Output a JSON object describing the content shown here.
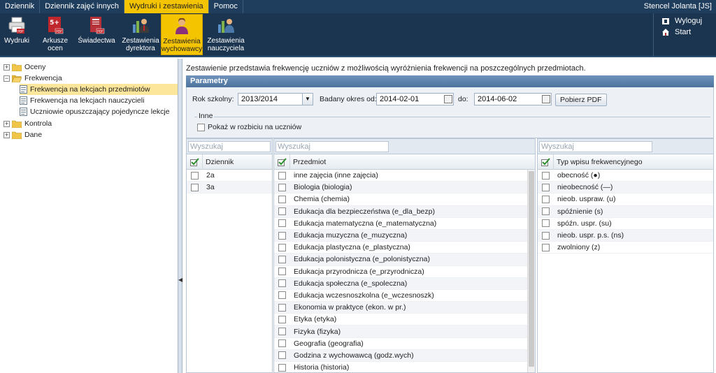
{
  "menubar": {
    "tabs": [
      "Dziennik",
      "Dziennik zajęć innych",
      "Wydruki i zestawienia",
      "Pomoc"
    ],
    "active_tab": "Wydruki i zestawienia",
    "user": "Stencel Jolanta [JS]"
  },
  "ribbon": {
    "buttons": [
      {
        "line1": "Wydruki",
        "line2": ""
      },
      {
        "line1": "Arkusze",
        "line2": "ocen"
      },
      {
        "line1": "Świadectwa",
        "line2": ""
      },
      {
        "line1": "Zestawienia",
        "line2": "dyrektora"
      },
      {
        "line1": "Zestawienia",
        "line2": "wychowawcy"
      },
      {
        "line1": "Zestawienia",
        "line2": "nauczyciela"
      }
    ],
    "badge_ocen": "5+",
    "pdf_badge": "PDF",
    "logout": "Wyloguj",
    "start": "Start"
  },
  "tree": {
    "oceny": "Oceny",
    "frekwencja": "Frekwencja",
    "freq_children": [
      "Frekwencja na lekcjach przedmiotów",
      "Frekwencja na lekcjach nauczycieli",
      "Uczniowie opuszczający pojedyncze lekcje"
    ],
    "kontrola": "Kontrola",
    "dane": "Dane",
    "expander_plus": "+",
    "expander_minus": "−"
  },
  "main": {
    "description": "Zestawienie przedstawia frekwencję uczniów z możliwością wyróżnienia frekwencji na poszczególnych przedmiotach.",
    "panel_title": "Parametry",
    "rok_label": "Rok szkolny:",
    "rok_value": "2013/2014",
    "okres_label": "Badany okres od:",
    "date_from": "2014-02-01",
    "do_label": "do:",
    "date_to": "2014-06-02",
    "pdf_button": "Pobierz PDF",
    "inne_legend": "Inne",
    "pokaz_label": "Pokaż w rozbiciu na uczniów",
    "dropdown_glyph": "▼"
  },
  "grids": {
    "search_placeholder": "Wyszukaj",
    "dziennik": {
      "header": "Dziennik",
      "rows": [
        "2a",
        "3a"
      ]
    },
    "przedmiot": {
      "header": "Przedmiot",
      "rows": [
        "inne zajęcia (inne zajęcia)",
        "Biologia (biologia)",
        "Chemia (chemia)",
        "Edukacja dla bezpieczeństwa (e_dla_bezp)",
        "Edukacja matematyczna (e_matematyczna)",
        "Edukacja muzyczna (e_muzyczna)",
        "Edukacja plastyczna (e_plastyczna)",
        "Edukacja polonistyczna (e_polonistyczna)",
        "Edukacja przyrodnicza (e_przyrodnicza)",
        "Edukacja społeczna (e_spoleczna)",
        "Edukacja wczesnoszkolna (e_wczesnoszk)",
        "Ekonomia w praktyce (ekon. w pr.)",
        "Etyka (etyka)",
        "Fizyka (fizyka)",
        "Geografia (geografia)",
        "Godzina z wychowawcą (godz.wych)",
        "Historia (historia)"
      ]
    },
    "typ": {
      "header": "Typ wpisu frekwencyjnego",
      "rows": [
        "obecność (●)",
        "nieobecność (—)",
        "nieob. uspraw. (u)",
        "spóźnienie (s)",
        "spóźn. uspr. (su)",
        "nieob. uspr. p.s. (ns)",
        "zwolniony (z)"
      ]
    }
  }
}
